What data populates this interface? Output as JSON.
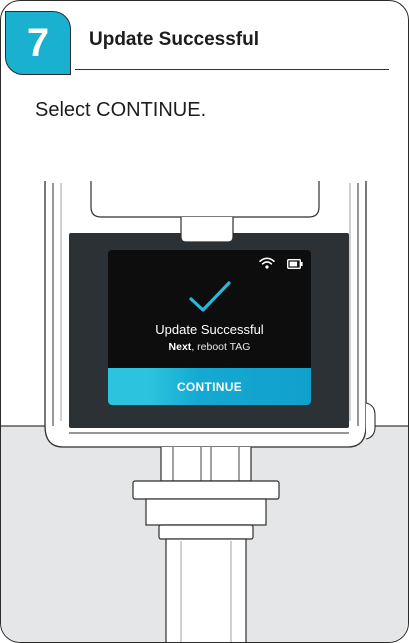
{
  "step": {
    "number": "7",
    "title": "Update Successful"
  },
  "instruction": "Select CONTINUE.",
  "device_screen": {
    "title": "Update Successful",
    "subtitle_bold": "Next",
    "subtitle_rest": ", reboot TAG",
    "button_label": "CONTINUE",
    "icons": [
      "wifi-icon",
      "battery-icon",
      "checkmark-icon"
    ]
  },
  "colors": {
    "accent": "#19b1cf",
    "button": "#14a9d2",
    "checkmark": "#29b8dc",
    "device_body": "#2b2f33",
    "screen": "#0d0d0d"
  }
}
